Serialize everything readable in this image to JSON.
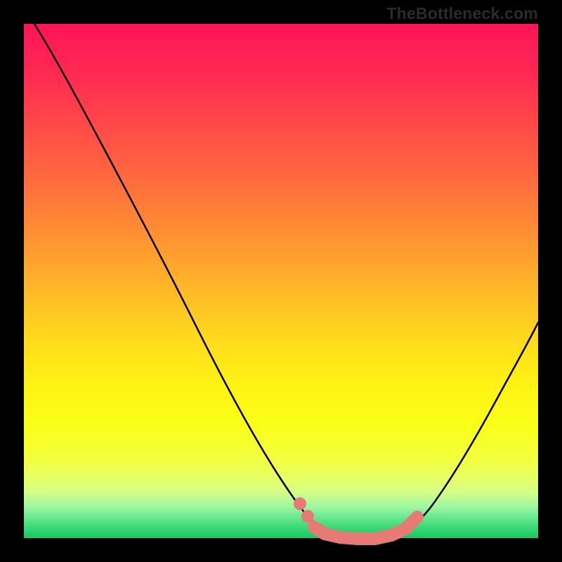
{
  "attribution": "TheBottleneck.com",
  "colors": {
    "background": "#000000",
    "curve": "#000000",
    "marker": "#e77a75",
    "gradient_stops": [
      "#ff1457",
      "#ff2a52",
      "#ff4a48",
      "#ff6a3e",
      "#ff8c34",
      "#ffb22a",
      "#ffd61e",
      "#fff214",
      "#faff18",
      "#f4ff3a",
      "#e8ff60",
      "#d6ff86",
      "#9cf7a0",
      "#4ee083",
      "#17c95f"
    ]
  },
  "chart_data": {
    "type": "line",
    "title": "",
    "xlabel": "",
    "ylabel": "",
    "xlim": [
      0,
      100
    ],
    "ylim": [
      0,
      100
    ],
    "grid": false,
    "legend_position": "none",
    "series": [
      {
        "name": "bottleneck-curve",
        "x": [
          2,
          7,
          12,
          18,
          24,
          30,
          36,
          42,
          48,
          52,
          56,
          60,
          63,
          66,
          69,
          72,
          75,
          78,
          81,
          85,
          89,
          93,
          97,
          100
        ],
        "y": [
          100,
          92,
          84,
          75,
          66,
          56,
          46,
          36,
          25,
          17,
          11,
          5,
          2,
          0,
          0,
          0,
          1,
          3,
          6,
          11,
          18,
          26,
          35,
          42
        ]
      }
    ],
    "optimal_region": {
      "x_start": 62,
      "x_end": 76,
      "y": 0
    },
    "annotations": []
  }
}
